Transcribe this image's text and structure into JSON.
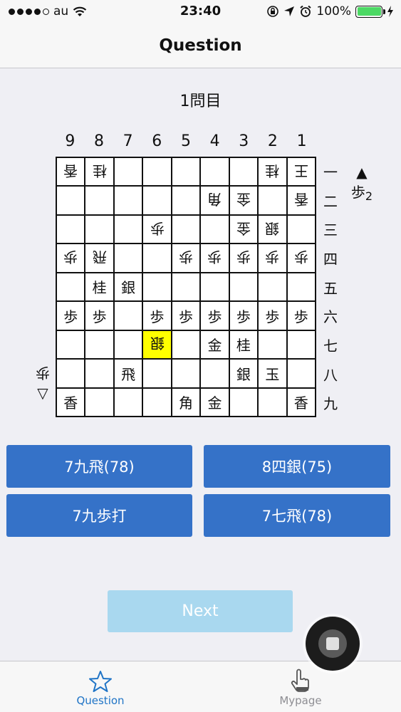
{
  "status_bar": {
    "carrier": "au",
    "time": "23:40",
    "battery_percent": "100%",
    "signal_bars": 4,
    "icons": [
      "wifi-icon",
      "rotation-lock-icon",
      "location-icon",
      "alarm-icon",
      "battery-icon",
      "charging-icon"
    ]
  },
  "nav": {
    "title": "Question"
  },
  "question_number": "1問目",
  "board": {
    "column_labels": [
      "9",
      "8",
      "7",
      "6",
      "5",
      "4",
      "3",
      "2",
      "1"
    ],
    "row_labels": [
      "一",
      "二",
      "三",
      "四",
      "五",
      "六",
      "七",
      "八",
      "九"
    ],
    "rows": [
      [
        {
          "p": "香",
          "g": true
        },
        {
          "p": "桂",
          "g": true
        },
        {
          "p": ""
        },
        {
          "p": ""
        },
        {
          "p": ""
        },
        {
          "p": ""
        },
        {
          "p": ""
        },
        {
          "p": "桂",
          "g": true
        },
        {
          "p": "王",
          "g": true
        }
      ],
      [
        {
          "p": ""
        },
        {
          "p": ""
        },
        {
          "p": ""
        },
        {
          "p": ""
        },
        {
          "p": ""
        },
        {
          "p": "角",
          "g": true
        },
        {
          "p": "金",
          "g": true
        },
        {
          "p": ""
        },
        {
          "p": "香",
          "g": true
        }
      ],
      [
        {
          "p": ""
        },
        {
          "p": ""
        },
        {
          "p": ""
        },
        {
          "p": "歩",
          "g": true
        },
        {
          "p": ""
        },
        {
          "p": ""
        },
        {
          "p": "金",
          "g": true
        },
        {
          "p": "銀",
          "g": true
        },
        {
          "p": ""
        }
      ],
      [
        {
          "p": "歩",
          "g": true
        },
        {
          "p": "飛",
          "g": true
        },
        {
          "p": ""
        },
        {
          "p": ""
        },
        {
          "p": "歩",
          "g": true
        },
        {
          "p": "歩",
          "g": true
        },
        {
          "p": "歩",
          "g": true
        },
        {
          "p": "歩",
          "g": true
        },
        {
          "p": "歩",
          "g": true
        }
      ],
      [
        {
          "p": ""
        },
        {
          "p": "桂"
        },
        {
          "p": "銀"
        },
        {
          "p": ""
        },
        {
          "p": ""
        },
        {
          "p": ""
        },
        {
          "p": ""
        },
        {
          "p": ""
        },
        {
          "p": ""
        }
      ],
      [
        {
          "p": "歩"
        },
        {
          "p": "歩"
        },
        {
          "p": ""
        },
        {
          "p": "歩"
        },
        {
          "p": "歩"
        },
        {
          "p": "歩"
        },
        {
          "p": "歩"
        },
        {
          "p": "歩"
        },
        {
          "p": "歩"
        }
      ],
      [
        {
          "p": ""
        },
        {
          "p": ""
        },
        {
          "p": ""
        },
        {
          "p": "銀",
          "g": true,
          "hl": true
        },
        {
          "p": ""
        },
        {
          "p": "金"
        },
        {
          "p": "桂"
        },
        {
          "p": ""
        },
        {
          "p": ""
        }
      ],
      [
        {
          "p": ""
        },
        {
          "p": ""
        },
        {
          "p": "飛"
        },
        {
          "p": ""
        },
        {
          "p": ""
        },
        {
          "p": ""
        },
        {
          "p": "銀"
        },
        {
          "p": "玉"
        },
        {
          "p": ""
        }
      ],
      [
        {
          "p": "香"
        },
        {
          "p": ""
        },
        {
          "p": ""
        },
        {
          "p": ""
        },
        {
          "p": "角"
        },
        {
          "p": "金"
        },
        {
          "p": ""
        },
        {
          "p": ""
        },
        {
          "p": "香"
        }
      ]
    ],
    "highlight_color": "#ffff00"
  },
  "sente_hand": {
    "mark": "▲",
    "piece": "歩",
    "count": "2"
  },
  "gote_hand": {
    "piece": "歩",
    "mark": "▽"
  },
  "answers": [
    "7九飛(78)",
    "8四銀(75)",
    "7九歩打",
    "7七飛(78)"
  ],
  "answer_color": "#3572c8",
  "next_label": "Next",
  "next_color": "#a9d8ef",
  "tabs": [
    {
      "label": "Question",
      "icon": "star-icon",
      "active": true,
      "color": "#1f74c6"
    },
    {
      "label": "Mypage",
      "icon": "hand-pointer-icon",
      "active": false,
      "color": "#8e8e93"
    }
  ]
}
